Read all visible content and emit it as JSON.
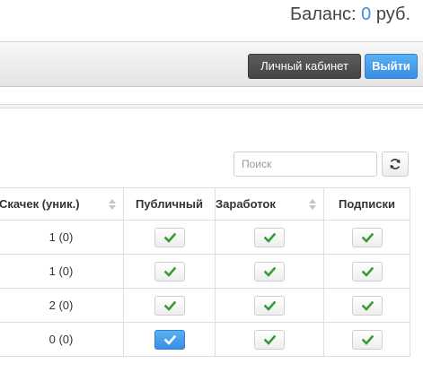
{
  "header": {
    "balance_label": "Баланс:",
    "balance_amount": "0",
    "balance_currency": "руб.",
    "cabinet_button": "Личный кабинет",
    "logout_button": "Выйти"
  },
  "search": {
    "placeholder": "Поиск"
  },
  "colors": {
    "accent": "#3a8ee6",
    "check_green": "#3a9a3a",
    "dark_button": "#4f4f4f"
  },
  "table": {
    "columns": [
      "Скачек (уник.)",
      "Публичный",
      "Заработок",
      "Подписки"
    ],
    "rows": [
      {
        "downloads": "1 (0)",
        "public": true,
        "public_active": false,
        "earnings": true,
        "subscriptions": true
      },
      {
        "downloads": "1 (0)",
        "public": true,
        "public_active": false,
        "earnings": true,
        "subscriptions": true
      },
      {
        "downloads": "2 (0)",
        "public": true,
        "public_active": false,
        "earnings": true,
        "subscriptions": true
      },
      {
        "downloads": "0 (0)",
        "public": true,
        "public_active": true,
        "earnings": true,
        "subscriptions": true
      }
    ]
  }
}
